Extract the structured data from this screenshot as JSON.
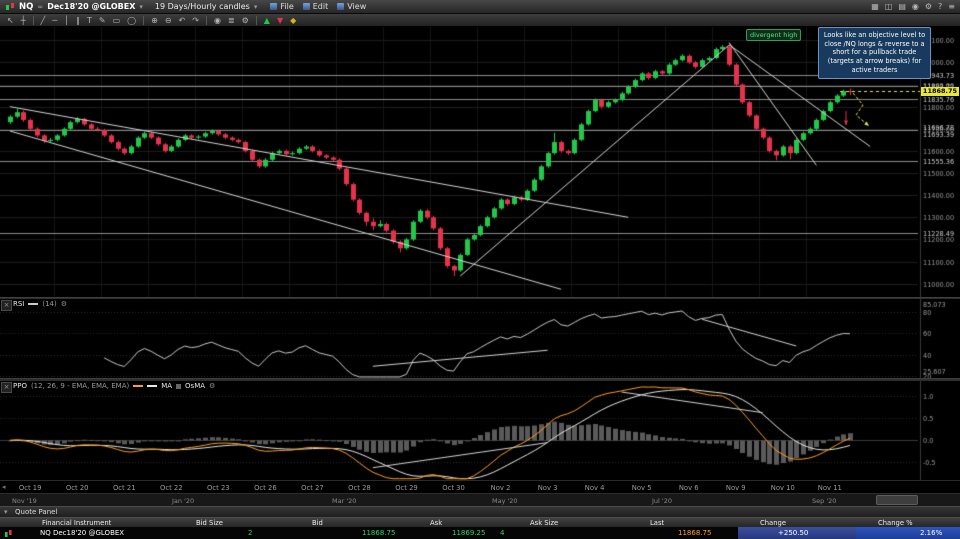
{
  "ui": {
    "close_glyph": "×",
    "gear_glyph": "⚙",
    "left_arrow_glyph": "◂"
  },
  "titlebar": {
    "symbol": "NQ",
    "continuous": "∞",
    "contract": "Dec18'20 @GLOBEX",
    "dropdown_arrow": "▾",
    "timeframe": "19 Days/Hourly candles",
    "menus": [
      {
        "label": "File"
      },
      {
        "label": "Edit"
      },
      {
        "label": "View"
      }
    ],
    "right_icons": [
      {
        "name": "layout-grid-icon",
        "glyph": "▦"
      },
      {
        "name": "new-window-icon",
        "glyph": "◫"
      },
      {
        "name": "print-icon",
        "glyph": "▤"
      },
      {
        "name": "snapshot-icon",
        "glyph": "◉"
      },
      {
        "name": "settings-gear-icon",
        "glyph": "⚙"
      },
      {
        "name": "help-icon",
        "glyph": "?"
      },
      {
        "name": "app-menu-icon",
        "glyph": "≡"
      }
    ]
  },
  "toolbar": {
    "icons": [
      {
        "name": "pointer-tool-icon",
        "glyph": "↖"
      },
      {
        "name": "crosshair-tool-icon",
        "glyph": "┼"
      },
      {
        "sep": true
      },
      {
        "name": "trendline-tool-icon",
        "glyph": "╱"
      },
      {
        "name": "horizontal-line-tool-icon",
        "glyph": "─"
      },
      {
        "name": "vertical-line-tool-icon",
        "glyph": "│"
      },
      {
        "name": "channel-tool-icon",
        "glyph": "∥"
      },
      {
        "name": "text-tool-icon",
        "glyph": "T"
      },
      {
        "name": "draw-tool-icon",
        "glyph": "✎"
      },
      {
        "name": "rectangle-tool-icon",
        "glyph": "▭"
      },
      {
        "name": "ellipse-tool-icon",
        "glyph": "◯"
      },
      {
        "sep": true
      },
      {
        "name": "zoom-in-icon",
        "glyph": "⊕"
      },
      {
        "name": "zoom-out-icon",
        "glyph": "⊖"
      },
      {
        "name": "undo-icon",
        "glyph": "↶"
      },
      {
        "name": "redo-icon",
        "glyph": "↷"
      },
      {
        "sep": true
      },
      {
        "name": "camera-icon",
        "glyph": "◉"
      },
      {
        "name": "layers-icon",
        "glyph": "≣"
      },
      {
        "name": "indicator-settings-icon",
        "glyph": "⚙"
      },
      {
        "sep": true
      },
      {
        "name": "buy-marker-icon",
        "glyph": "▲",
        "color": "#21c84a"
      },
      {
        "name": "sell-marker-icon",
        "glyph": "▼",
        "color": "#e6324b"
      },
      {
        "name": "alert-icon",
        "glyph": "◆",
        "color": "#d6b41e"
      }
    ]
  },
  "colors": {
    "up": "#21c84a",
    "down": "#e6324b",
    "accent_yellow": "#e8e838",
    "rsi_line": "#c9c9c9",
    "ppo_line": "#ff9e1b",
    "ppo_signal": "#e8e8e8",
    "osma": "#5a5a5a",
    "level_line": "#8c8c8c",
    "trendline": "#d5d5d5",
    "axis_text": "#9a9a9a",
    "level_text": "#cfcfcf"
  },
  "chart_data": {
    "type": "candlestick",
    "title": "NQ Dec18'20 @GLOBEX — 19 Days/Hourly candles",
    "ylim": [
      10940,
      12160
    ],
    "y_ticks": [
      11000,
      11100,
      11200,
      11300,
      11400,
      11500,
      11600,
      11700,
      11800,
      11900,
      12000,
      12100
    ],
    "x_labels": [
      "Oct 19",
      "Oct 20",
      "Oct 21",
      "Oct 22",
      "Oct 23",
      "Oct 26",
      "Oct 27",
      "Oct 28",
      "Oct 29",
      "Oct 30",
      "Nov 2",
      "Nov 3",
      "Nov 4",
      "Nov 5",
      "Nov 6",
      "Nov 9",
      "Nov 10",
      "Nov 11"
    ],
    "candles_per_day": 7,
    "candles": [
      [
        11730,
        11762,
        11722,
        11755
      ],
      [
        11755,
        11790,
        11748,
        11775
      ],
      [
        11775,
        11782,
        11731,
        11740
      ],
      [
        11740,
        11747,
        11692,
        11700
      ],
      [
        11700,
        11707,
        11662,
        11670
      ],
      [
        11670,
        11676,
        11636,
        11645
      ],
      [
        11645,
        11659,
        11639,
        11650
      ],
      [
        11650,
        11676,
        11644,
        11670
      ],
      [
        11670,
        11706,
        11664,
        11700
      ],
      [
        11700,
        11737,
        11694,
        11730
      ],
      [
        11730,
        11752,
        11724,
        11745
      ],
      [
        11745,
        11750,
        11713,
        11720
      ],
      [
        11720,
        11726,
        11693,
        11700
      ],
      [
        11700,
        11708,
        11688,
        11695
      ],
      [
        11695,
        11700,
        11663,
        11670
      ],
      [
        11670,
        11676,
        11633,
        11640
      ],
      [
        11640,
        11646,
        11602,
        11610
      ],
      [
        11610,
        11616,
        11582,
        11590
      ],
      [
        11590,
        11627,
        11584,
        11620
      ],
      [
        11620,
        11666,
        11614,
        11660
      ],
      [
        11660,
        11687,
        11654,
        11680
      ],
      [
        11680,
        11686,
        11653,
        11660
      ],
      [
        11660,
        11666,
        11623,
        11630
      ],
      [
        11630,
        11636,
        11592,
        11600
      ],
      [
        11600,
        11627,
        11594,
        11620
      ],
      [
        11620,
        11657,
        11614,
        11650
      ],
      [
        11650,
        11677,
        11644,
        11670
      ],
      [
        11670,
        11676,
        11652,
        11660
      ],
      [
        11660,
        11672,
        11653,
        11665
      ],
      [
        11665,
        11687,
        11659,
        11680
      ],
      [
        11680,
        11697,
        11674,
        11690
      ],
      [
        11690,
        11696,
        11668,
        11675
      ],
      [
        11675,
        11681,
        11653,
        11660
      ],
      [
        11660,
        11666,
        11643,
        11650
      ],
      [
        11650,
        11656,
        11633,
        11640
      ],
      [
        11640,
        11646,
        11592,
        11600
      ],
      [
        11600,
        11606,
        11552,
        11560
      ],
      [
        11560,
        11566,
        11522,
        11530
      ],
      [
        11530,
        11567,
        11524,
        11560
      ],
      [
        11560,
        11597,
        11554,
        11590
      ],
      [
        11590,
        11607,
        11584,
        11600
      ],
      [
        11600,
        11606,
        11578,
        11585
      ],
      [
        11585,
        11597,
        11579,
        11590
      ],
      [
        11590,
        11617,
        11584,
        11610
      ],
      [
        11610,
        11627,
        11604,
        11620
      ],
      [
        11620,
        11626,
        11593,
        11600
      ],
      [
        11600,
        11606,
        11573,
        11580
      ],
      [
        11580,
        11586,
        11563,
        11570
      ],
      [
        11570,
        11576,
        11553,
        11560
      ],
      [
        11560,
        11566,
        11512,
        11520
      ],
      [
        11520,
        11526,
        11442,
        11450
      ],
      [
        11450,
        11456,
        11372,
        11380
      ],
      [
        11380,
        11386,
        11312,
        11320
      ],
      [
        11320,
        11326,
        11262,
        11280
      ],
      [
        11280,
        11296,
        11242,
        11260
      ],
      [
        11260,
        11287,
        11254,
        11270
      ],
      [
        11270,
        11276,
        11232,
        11240
      ],
      [
        11240,
        11246,
        11182,
        11190
      ],
      [
        11190,
        11196,
        11142,
        11160
      ],
      [
        11160,
        11207,
        11154,
        11200
      ],
      [
        11200,
        11287,
        11194,
        11280
      ],
      [
        11280,
        11337,
        11274,
        11330
      ],
      [
        11330,
        11336,
        11292,
        11300
      ],
      [
        11300,
        11306,
        11242,
        11250
      ],
      [
        11250,
        11256,
        11152,
        11160
      ],
      [
        11160,
        11166,
        11072,
        11080
      ],
      [
        11080,
        11086,
        11035,
        11060
      ],
      [
        11060,
        11137,
        11054,
        11130
      ],
      [
        11130,
        11207,
        11124,
        11200
      ],
      [
        11200,
        11227,
        11194,
        11220
      ],
      [
        11220,
        11267,
        11214,
        11260
      ],
      [
        11260,
        11307,
        11254,
        11300
      ],
      [
        11300,
        11347,
        11294,
        11340
      ],
      [
        11340,
        11387,
        11334,
        11380
      ],
      [
        11380,
        11386,
        11352,
        11360
      ],
      [
        11360,
        11397,
        11354,
        11390
      ],
      [
        11390,
        11396,
        11372,
        11380
      ],
      [
        11380,
        11427,
        11374,
        11420
      ],
      [
        11420,
        11477,
        11414,
        11470
      ],
      [
        11470,
        11537,
        11464,
        11530
      ],
      [
        11530,
        11597,
        11524,
        11590
      ],
      [
        11590,
        11682,
        11584,
        11640
      ],
      [
        11640,
        11646,
        11592,
        11600
      ],
      [
        11600,
        11606,
        11582,
        11590
      ],
      [
        11590,
        11657,
        11584,
        11650
      ],
      [
        11650,
        11727,
        11644,
        11720
      ],
      [
        11720,
        11787,
        11714,
        11780
      ],
      [
        11780,
        11837,
        11774,
        11830
      ],
      [
        11830,
        11836,
        11792,
        11800
      ],
      [
        11800,
        11827,
        11794,
        11820
      ],
      [
        11820,
        11837,
        11814,
        11830
      ],
      [
        11830,
        11867,
        11824,
        11860
      ],
      [
        11860,
        11897,
        11854,
        11890
      ],
      [
        11890,
        11927,
        11884,
        11920
      ],
      [
        11920,
        11957,
        11914,
        11950
      ],
      [
        11950,
        11956,
        11922,
        11930
      ],
      [
        11930,
        11967,
        11924,
        11960
      ],
      [
        11960,
        11966,
        11942,
        11950
      ],
      [
        11950,
        11997,
        11944,
        11990
      ],
      [
        11990,
        12017,
        11984,
        12010
      ],
      [
        12010,
        12037,
        12004,
        12030
      ],
      [
        12030,
        12036,
        11992,
        12000
      ],
      [
        12000,
        12006,
        11972,
        11980
      ],
      [
        11980,
        12017,
        11974,
        12010
      ],
      [
        12010,
        12027,
        12004,
        12020
      ],
      [
        12020,
        12067,
        12014,
        12060
      ],
      [
        12060,
        12078,
        12054,
        12070
      ],
      [
        12070,
        12076,
        11982,
        11990
      ],
      [
        11990,
        11996,
        11892,
        11900
      ],
      [
        11900,
        11906,
        11812,
        11820
      ],
      [
        11820,
        11826,
        11752,
        11760
      ],
      [
        11760,
        11766,
        11692,
        11700
      ],
      [
        11700,
        11706,
        11652,
        11660
      ],
      [
        11660,
        11666,
        11592,
        11600
      ],
      [
        11600,
        11606,
        11558,
        11580
      ],
      [
        11580,
        11627,
        11574,
        11620
      ],
      [
        11620,
        11626,
        11562,
        11590
      ],
      [
        11590,
        11657,
        11584,
        11650
      ],
      [
        11650,
        11687,
        11644,
        11680
      ],
      [
        11680,
        11707,
        11674,
        11700
      ],
      [
        11700,
        11747,
        11694,
        11740
      ],
      [
        11740,
        11787,
        11734,
        11780
      ],
      [
        11780,
        11827,
        11774,
        11820
      ],
      [
        11820,
        11857,
        11814,
        11850
      ],
      [
        11850,
        11877,
        11844,
        11870
      ],
      [
        11870,
        11882,
        11852,
        11868.75
      ]
    ],
    "levels": [
      {
        "price": 11943.73
      },
      {
        "price": 11893.71
      },
      {
        "price": 11835.76
      },
      {
        "price": 11696.78,
        "label_dy": -3
      },
      {
        "price": 11693.39,
        "dashed": true,
        "label_dy": 4
      },
      {
        "price": 11555.36
      },
      {
        "price": 11228.49
      }
    ],
    "trendlines_main": [
      [
        0,
        11800,
        92,
        11300
      ],
      [
        0,
        11690,
        82,
        10975
      ],
      [
        67,
        11035,
        107,
        12078
      ],
      [
        107,
        12090,
        120,
        11535
      ],
      [
        107,
        12080,
        128,
        11620
      ]
    ],
    "arrows": [
      {
        "name": "pullback-path-arrow",
        "color": "#e8e838",
        "dashed": true,
        "points": [
          [
            853,
            66
          ],
          [
            863,
            78
          ],
          [
            856,
            88
          ],
          [
            869,
            99
          ]
        ]
      },
      {
        "name": "breakdown-arrow",
        "color": "#e6324b",
        "dashed": false,
        "points": [
          [
            846,
            84
          ],
          [
            846,
            98
          ]
        ]
      }
    ],
    "annotations": {
      "note_text": "Looks like an objective level to close /NQ longs & reverse to a short for a pullback trade (targets at arrow breaks) for active traders",
      "divergent_label": "divergent high",
      "last_price": "11868.75"
    },
    "rsi": {
      "label": "RSI",
      "params": "(14)",
      "period": 14,
      "ylim": [
        18,
        92
      ],
      "gridlines": [
        80,
        60,
        40,
        20
      ],
      "high_label": "85.073",
      "low_label": "25.607",
      "trendlines": [
        [
          54,
          29,
          80,
          44
        ],
        [
          103,
          73,
          117,
          48
        ]
      ]
    },
    "ppo": {
      "label": "PPO",
      "params": "(12, 26, 9 - EMA, EMA, EMA)",
      "ma_label": "MA",
      "osma_label": "OsMA",
      "fast": 12,
      "slow": 26,
      "signal": 9,
      "ylim": [
        -0.9,
        1.35
      ],
      "gridlines": [
        1.0,
        0.5,
        0.0,
        -0.5
      ],
      "trendlines": [
        [
          54,
          -0.62,
          80,
          -0.05
        ],
        [
          91,
          1.1,
          112,
          0.63
        ]
      ]
    },
    "timeline": {
      "labels": [
        "Nov '19",
        "Jan '20",
        "Mar '20",
        "May '20",
        "Jul '20",
        "Sep '20"
      ]
    }
  },
  "quote_panel": {
    "title": "Quote Panel",
    "collapse_arrow": "▾",
    "columns": [
      "Financial Instrument",
      "Bid Size",
      "Bid",
      "Ask",
      "Ask Size",
      "Last",
      "Change",
      "Change %"
    ],
    "row": {
      "instrument": "NQ Dec18'20 @GLOBEX",
      "bid_size": "2",
      "bid": "11868.75",
      "ask": "11869.25",
      "ask_size": "4",
      "last": "11868.75",
      "change": "+250.50",
      "change_pct": "2.16%"
    }
  }
}
